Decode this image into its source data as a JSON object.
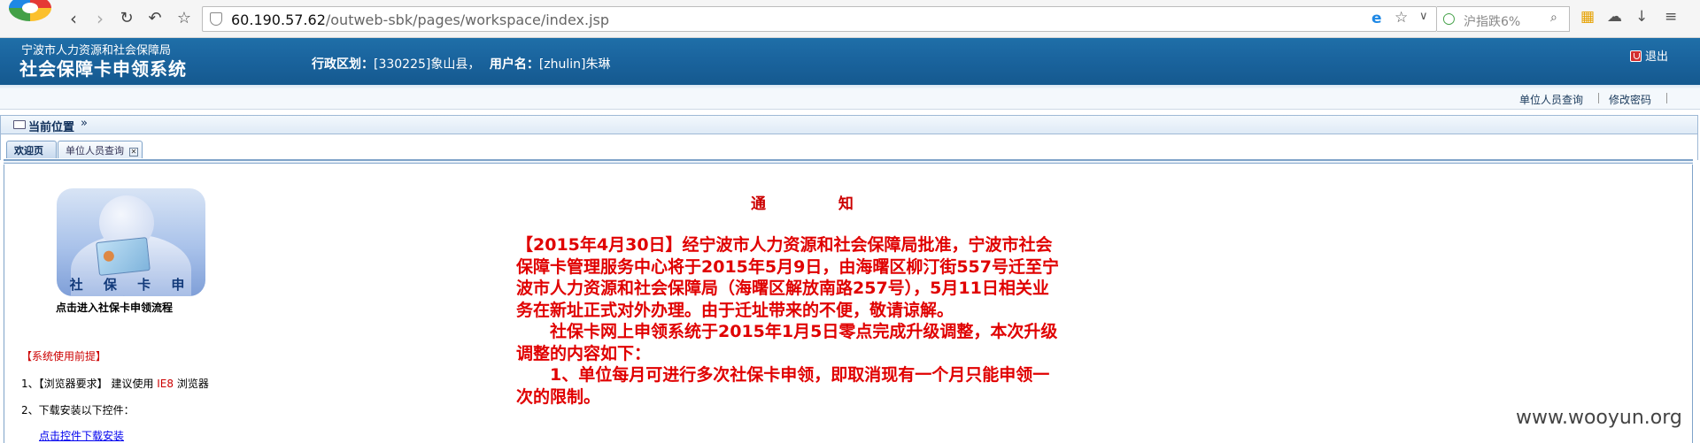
{
  "browser": {
    "url_host": "60.190.57.62",
    "url_path": "/outweb-sbk/pages/workspace/index.jsp",
    "search_placeholder": "沪指跌6%"
  },
  "header": {
    "subtitle": "宁波市人力资源和社会保障局",
    "title": "社会保障卡申领系统",
    "region_label": "行政区划：",
    "region_value": "[330225]象山县，",
    "user_label": "用户名：",
    "user_value": "[zhulin]朱琳",
    "logout": "退出"
  },
  "toplinks": {
    "query": "单位人员查询",
    "change_password": "修改密码"
  },
  "location": {
    "label": "当前位置",
    "chevron": "»"
  },
  "tabs": [
    {
      "label": "欢迎页"
    },
    {
      "label": "单位人员查询"
    }
  ],
  "card": {
    "caption": "社 保 卡 申 领",
    "label": "点击进入社保卡申领流程"
  },
  "notes": {
    "title": "【系统使用前提】",
    "line1_prefix": "1、【浏览器要求】 建议使用 ",
    "line1_ie": "IE8",
    "line1_suffix": " 浏览器",
    "line2": "2、下载安装以下控件：",
    "link": "点击控件下载安装"
  },
  "notice": {
    "title": "通 知",
    "para1": "【2015年4月30日】经宁波市人力资源和社会保障局批准，宁波市社会保障卡管理服务中心将于2015年5月9日，由海曙区柳汀街557号迁至宁波市人力资源和社会保障局（海曙区解放南路257号），5月11日相关业务在新址正式对外办理。由于迁址带来的不便，敬请谅解。",
    "para2": "社保卡网上申领系统于2015年1月5日零点完成升级调整，本次升级调整的内容如下：",
    "para3": "1、单位每月可进行多次社保卡申领，即取消现有一个月只能申领一次的限制。"
  },
  "watermark": "www.wooyun.org"
}
